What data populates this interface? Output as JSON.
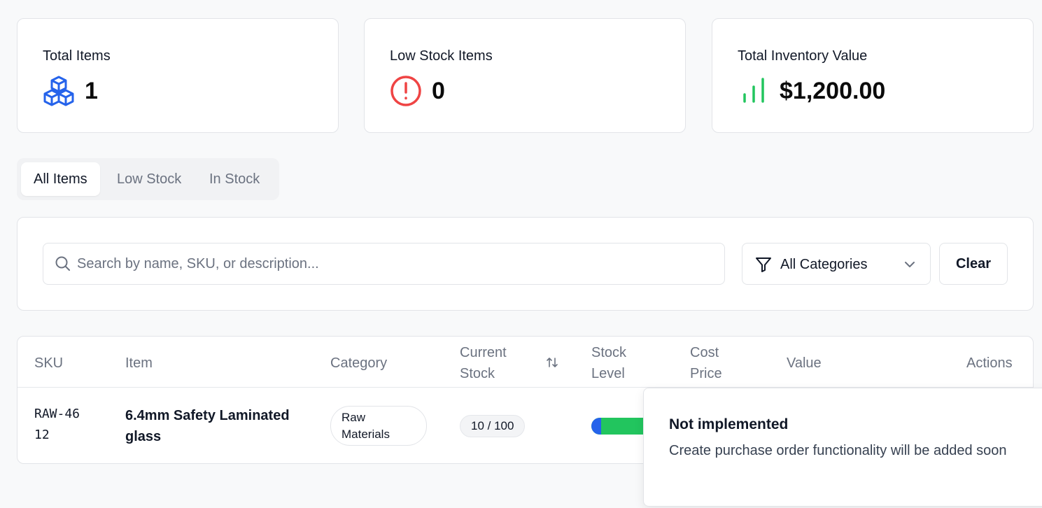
{
  "stats": {
    "total_items": {
      "title": "Total Items",
      "value": "1",
      "icon": "cubes-icon",
      "color": "#2563eb"
    },
    "low_stock": {
      "title": "Low Stock Items",
      "value": "0",
      "icon": "alert-circle-icon",
      "color": "#ef4444"
    },
    "inventory_value": {
      "title": "Total Inventory Value",
      "value": "$1,200.00",
      "icon": "bar-chart-icon",
      "color": "#22c55e"
    }
  },
  "tabs": [
    {
      "label": "All Items",
      "active": true
    },
    {
      "label": "Low Stock",
      "active": false
    },
    {
      "label": "In Stock",
      "active": false
    }
  ],
  "filters": {
    "search_placeholder": "Search by name, SKU, or description...",
    "search_value": "",
    "category_selected": "All Categories",
    "clear_label": "Clear"
  },
  "table": {
    "columns": [
      "SKU",
      "Item",
      "Category",
      "Current Stock",
      "Stock Level",
      "Cost Price",
      "Value",
      "Actions"
    ],
    "rows": [
      {
        "sku": "RAW-4612",
        "item": "6.4mm Safety Laminated glass",
        "category": "Raw Materials",
        "current_stock": "10 / 100",
        "stock_level_fraction": 0.1
      }
    ]
  },
  "toast": {
    "title": "Not implemented",
    "description": "Create purchase order functionality will be added soon"
  }
}
